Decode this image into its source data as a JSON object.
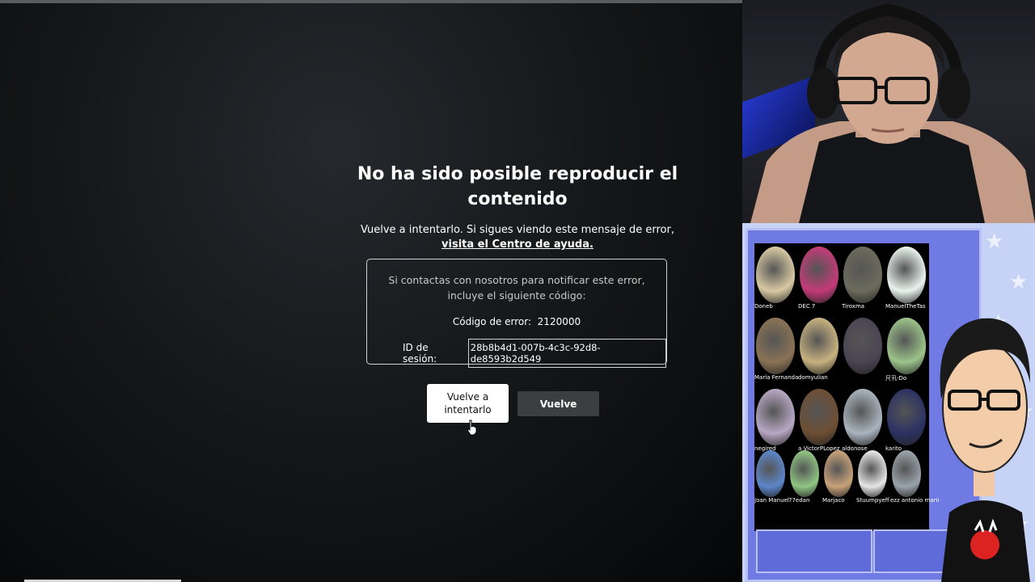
{
  "error": {
    "title": "No ha sido posible reproducir el contenido",
    "message": "Vuelve a intentarlo. Si sigues viendo este mensaje de error,",
    "help_link": "visita el Centro de ayuda.",
    "contact_text": "Si contactas con nosotros para notificar este error, incluye el siguiente código:",
    "code_label": "Código de error:",
    "code_value": "2120000",
    "session_label": "ID de sesión:",
    "session_value": "28b8b4d1-007b-4c3c-92d8-de8593b2d549",
    "retry_button": "Vuelve a intentarlo",
    "back_button": "Vuelve"
  },
  "overlay": {
    "avatars": [
      {
        "name": "Doneb",
        "color": "#d8c9a3"
      },
      {
        "name": "DEC 7",
        "color": "#c33b78"
      },
      {
        "name": "Tiroxma",
        "color": "#6c6b5c"
      },
      {
        "name": "ManuelTheTas",
        "color": "#e9f3ee"
      },
      {
        "name": "María Fernanda",
        "color": "#8a7355"
      },
      {
        "name": "domyulian",
        "color": "#c7b17f"
      },
      {
        "name": "",
        "color": "#4b4453"
      },
      {
        "name": "尺卂-Do",
        "color": "#9cc38a"
      },
      {
        "name": "negired",
        "color": "#b8a7c4"
      },
      {
        "name": "a VictorPLopez",
        "color": "#6e4f34"
      },
      {
        "name": "aldonose",
        "color": "#aab4be"
      },
      {
        "name": "karito",
        "color": "#2c3263"
      },
      {
        "name": "Joan Manuel",
        "color": "#5d86c9"
      },
      {
        "name": "77edan",
        "color": "#8fc582"
      },
      {
        "name": "Marjaco",
        "color": "#c9a27a"
      },
      {
        "name": "Stuumpyeff",
        "color": "#e6e6e6"
      },
      {
        "name": "ezz antonio marín",
        "color": "#9aa3ab"
      }
    ]
  }
}
